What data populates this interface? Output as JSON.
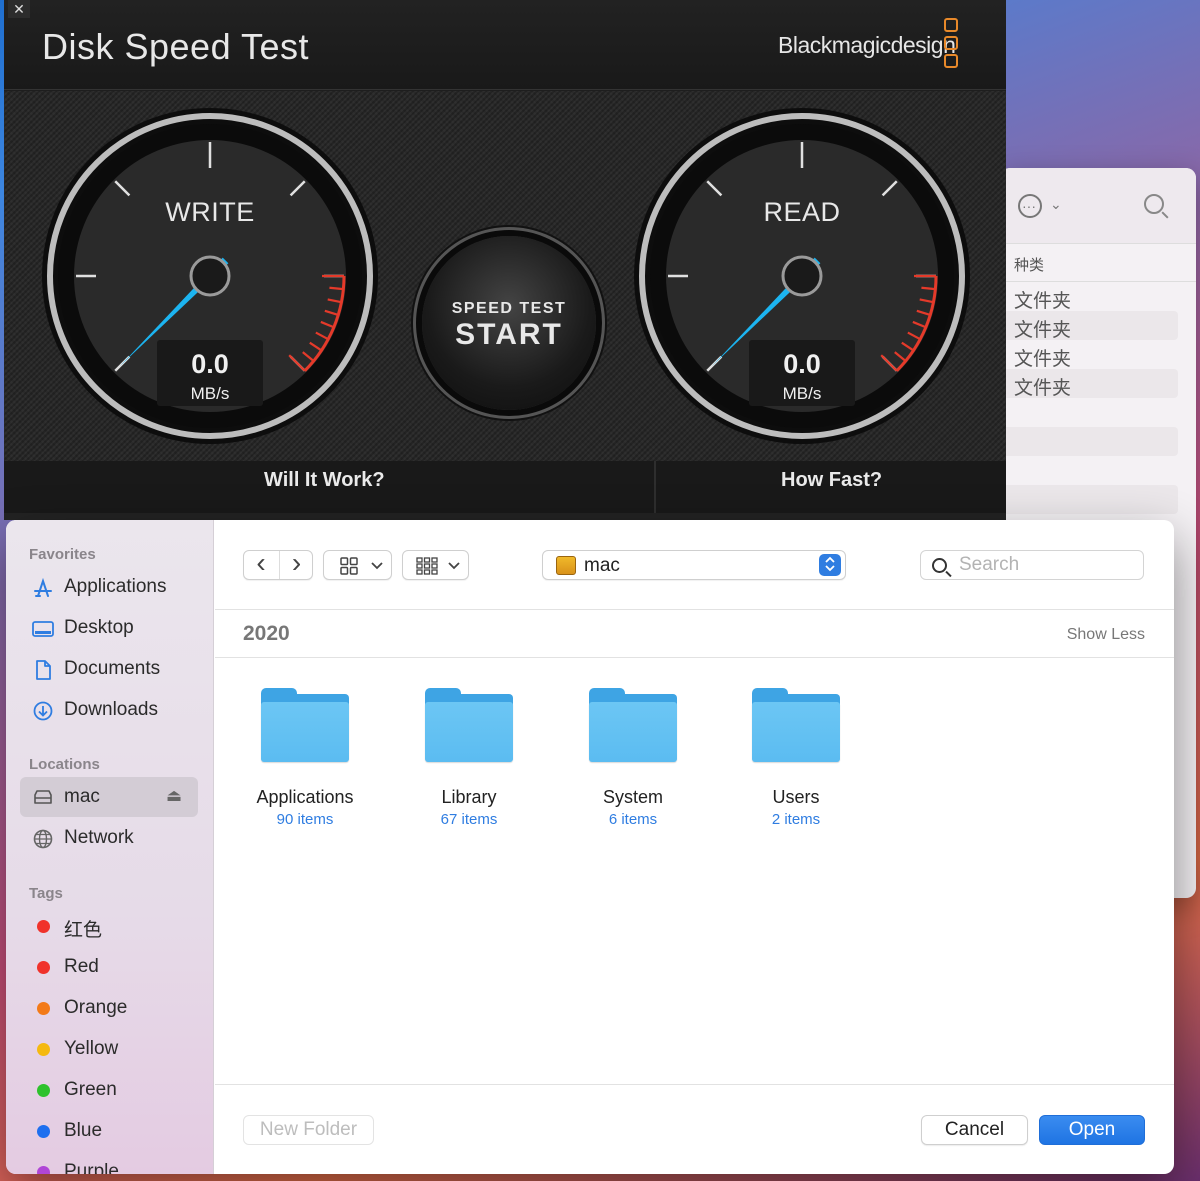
{
  "background_finder": {
    "column_header": "种类",
    "rows": [
      "文件夹",
      "文件夹",
      "文件夹",
      "文件夹"
    ]
  },
  "disk_speed_test": {
    "close_glyph": "✕",
    "title": "Disk Speed Test",
    "brand": "Blackmagicdesign",
    "write_gauge": {
      "label": "WRITE",
      "value": "0.0",
      "unit": "MB/s"
    },
    "read_gauge": {
      "label": "READ",
      "value": "0.0",
      "unit": "MB/s"
    },
    "start_button": {
      "line1": "SPEED TEST",
      "line2": "START"
    },
    "settings_glyph": "⚙",
    "section_will_it_work": "Will It Work?",
    "section_how_fast": "How Fast?",
    "colors": {
      "needle": "#1cb4f0",
      "redline": "#e53a2a",
      "brand_orange": "#e8892a"
    }
  },
  "sidebar": {
    "favorites_label": "Favorites",
    "favorites": [
      {
        "label": "Applications",
        "icon": "applications-icon"
      },
      {
        "label": "Desktop",
        "icon": "desktop-icon"
      },
      {
        "label": "Documents",
        "icon": "document-icon"
      },
      {
        "label": "Downloads",
        "icon": "download-icon"
      }
    ],
    "locations_label": "Locations",
    "locations": [
      {
        "label": "mac",
        "icon": "disk-icon",
        "eject": "⏏"
      },
      {
        "label": "Network",
        "icon": "globe-icon"
      }
    ],
    "tags_label": "Tags",
    "tags": [
      {
        "label": "红色",
        "color": "#f0322b"
      },
      {
        "label": "Red",
        "color": "#f0322b"
      },
      {
        "label": "Orange",
        "color": "#f37a18"
      },
      {
        "label": "Yellow",
        "color": "#f5b90f"
      },
      {
        "label": "Green",
        "color": "#2ec22c"
      },
      {
        "label": "Blue",
        "color": "#1e6fef"
      },
      {
        "label": "Purple",
        "color": "#b046d6"
      }
    ]
  },
  "toolbar": {
    "back_glyph": "‹",
    "forward_glyph": "›",
    "location": "mac",
    "search_placeholder": "Search",
    "stepper_glyph": "⌃⌄"
  },
  "content": {
    "group_title": "2020",
    "group_action": "Show Less",
    "items": [
      {
        "name": "Applications",
        "count": "90 items"
      },
      {
        "name": "Library",
        "count": "67 items"
      },
      {
        "name": "System",
        "count": "6 items"
      },
      {
        "name": "Users",
        "count": "2 items"
      }
    ]
  },
  "footer": {
    "new_folder": "New Folder",
    "cancel": "Cancel",
    "open": "Open"
  }
}
